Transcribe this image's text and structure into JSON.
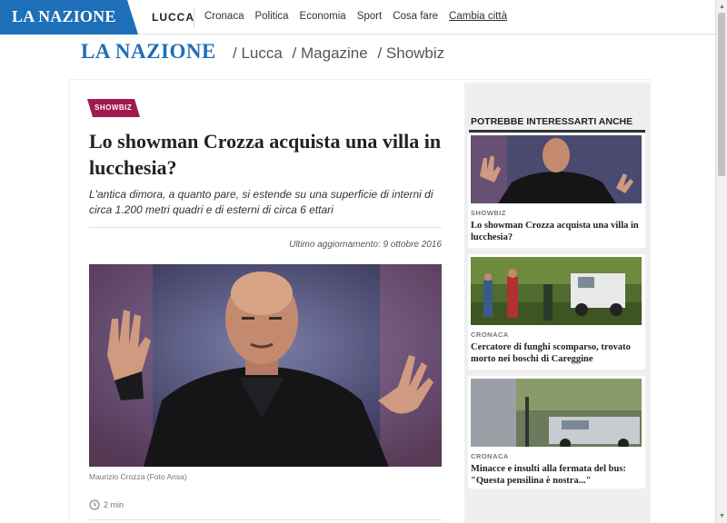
{
  "topbar": {
    "logo": "LA NAZIONE",
    "city": "LUCCA",
    "nav": [
      "Cronaca",
      "Politica",
      "Economia",
      "Sport",
      "Cosa fare"
    ],
    "change_city": "Cambia città"
  },
  "header": {
    "brand": "LA NAZIONE",
    "breadcrumbs": [
      "/ Lucca",
      "/ Magazine",
      "/ Showbiz"
    ]
  },
  "article": {
    "tag": "SHOWBIZ",
    "headline": "Lo showman Crozza acquista una villa in lucchesia?",
    "subhead": "L'antica dimora, a quanto pare, si estende su una superficie di interni di circa 1.200 metri quadri e di esterni di circa 6 ettari",
    "updated": "Ultimo aggiornamento: 9 ottobre 2016",
    "caption": "Maurizio Crozza (Foto Ansa)",
    "read_time": "2 min"
  },
  "sidebar": {
    "title": "POTREBBE INTERESSARTI ANCHE",
    "cards": [
      {
        "category": "SHOWBIZ",
        "title": "Lo showman Crozza acquista una villa in lucchesia?"
      },
      {
        "category": "CRONACA",
        "title": "Cercatore di funghi scomparso, trovato morto nei boschi di Careggine"
      },
      {
        "category": "CRONACA",
        "title": "Minacce e insulti alla fermata del bus: \"Questa pensilina è nostra...\""
      }
    ]
  },
  "colors": {
    "brand_blue": "#1d6fb8",
    "tag_magenta": "#a0194f"
  }
}
